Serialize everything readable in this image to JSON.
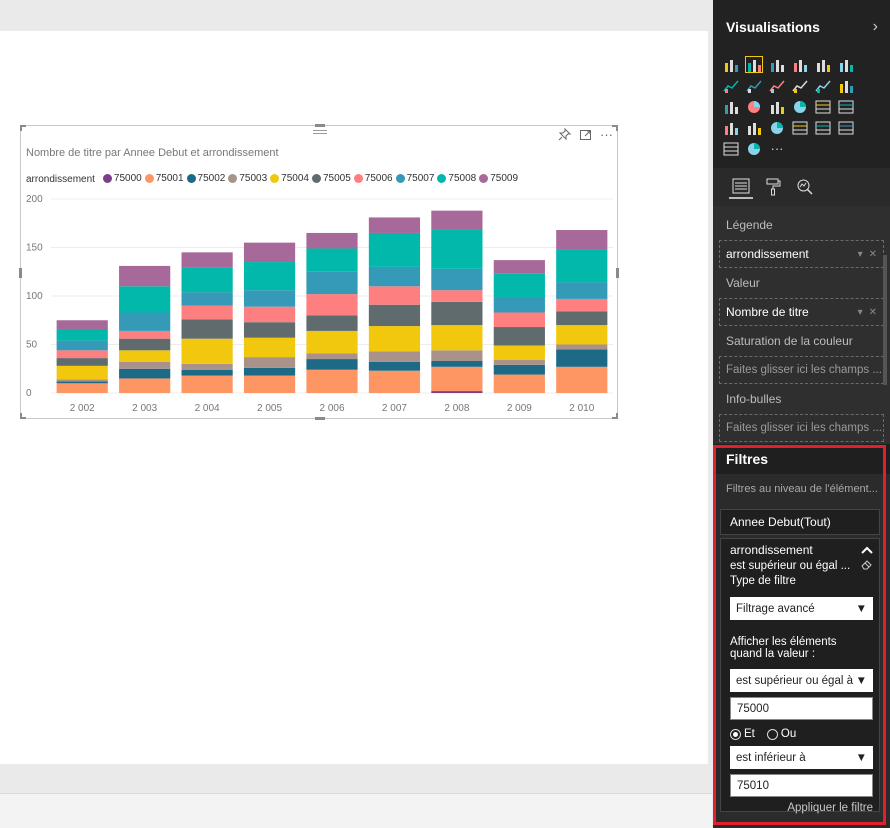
{
  "chart_data": {
    "type": "bar",
    "stacked": true,
    "title": "Nombre de titre par Annee Debut et arrondissement",
    "legend_title": "arrondissement",
    "categories": [
      "2 002",
      "2 003",
      "2 004",
      "2 005",
      "2 006",
      "2 007",
      "2 008",
      "2 009",
      "2 010"
    ],
    "ylim": [
      0,
      200
    ],
    "yticks": [
      0,
      50,
      100,
      150,
      200
    ],
    "grid": true,
    "legend_position": "top-left",
    "series": [
      {
        "name": "75000",
        "color": "#7b3f88",
        "values": [
          0,
          0,
          0,
          0,
          0,
          0,
          2,
          0,
          0
        ]
      },
      {
        "name": "75001",
        "color": "#fd9663",
        "values": [
          10,
          15,
          18,
          18,
          24,
          23,
          25,
          19,
          27
        ]
      },
      {
        "name": "75002",
        "color": "#1d6a86",
        "values": [
          2,
          10,
          6,
          8,
          11,
          9,
          6,
          10,
          18
        ]
      },
      {
        "name": "75003",
        "color": "#a8928a",
        "values": [
          2,
          7,
          6,
          11,
          6,
          11,
          11,
          5,
          5
        ]
      },
      {
        "name": "75004",
        "color": "#f2c80f",
        "values": [
          14,
          12,
          26,
          20,
          23,
          26,
          26,
          15,
          20
        ]
      },
      {
        "name": "75005",
        "color": "#5f6b6d",
        "values": [
          8,
          12,
          20,
          16,
          16,
          22,
          24,
          19,
          14
        ]
      },
      {
        "name": "75006",
        "color": "#fd7f7f",
        "values": [
          8,
          8,
          14,
          16,
          22,
          19,
          12,
          15,
          13
        ]
      },
      {
        "name": "75007",
        "color": "#3599b8",
        "values": [
          10,
          19,
          14,
          17,
          23,
          20,
          22,
          16,
          17
        ]
      },
      {
        "name": "75008",
        "color": "#01b8aa",
        "values": [
          12,
          27,
          25,
          29,
          24,
          35,
          41,
          24,
          34
        ]
      },
      {
        "name": "75009",
        "color": "#a66999",
        "values": [
          9,
          21,
          16,
          20,
          16,
          16,
          19,
          14,
          20
        ]
      }
    ]
  },
  "visual_header": {
    "pin_icon": "pin-icon",
    "focus_icon": "focus-mode-icon",
    "more": "···"
  },
  "visualisations": {
    "title": "Visualisations",
    "collapse": "›",
    "more": "···"
  },
  "fields": {
    "legende_label": "Légende",
    "legende_value": "arrondissement",
    "valeur_label": "Valeur",
    "valeur_value": "Nombre de titre",
    "saturation_label": "Saturation de la couleur",
    "saturation_placeholder": "Faites glisser ici les champs ...",
    "infobulles_label": "Info-bulles",
    "infobulles_placeholder": "Faites glisser ici les champs ..."
  },
  "filters": {
    "title": "Filtres",
    "level_label": "Filtres au niveau de l'élément...",
    "annee_card": "Annee Debut(Tout)",
    "arr_card": {
      "field": "arrondissement",
      "summary": "est supérieur ou égal ...",
      "filter_type_label": "Type de filtre",
      "filter_type_value": "Filtrage avancé",
      "show_items_label": "Afficher les éléments quand la valeur :",
      "condition1": "est supérieur ou égal à",
      "value1": "75000",
      "and_label": "Et",
      "or_label": "Ou",
      "condition2": "est inférieur à",
      "value2": "75010",
      "apply_label": "Appliquer le filtre"
    }
  },
  "colors": {
    "highlight": "#e0202b",
    "selected_visual": "#f2c811"
  }
}
